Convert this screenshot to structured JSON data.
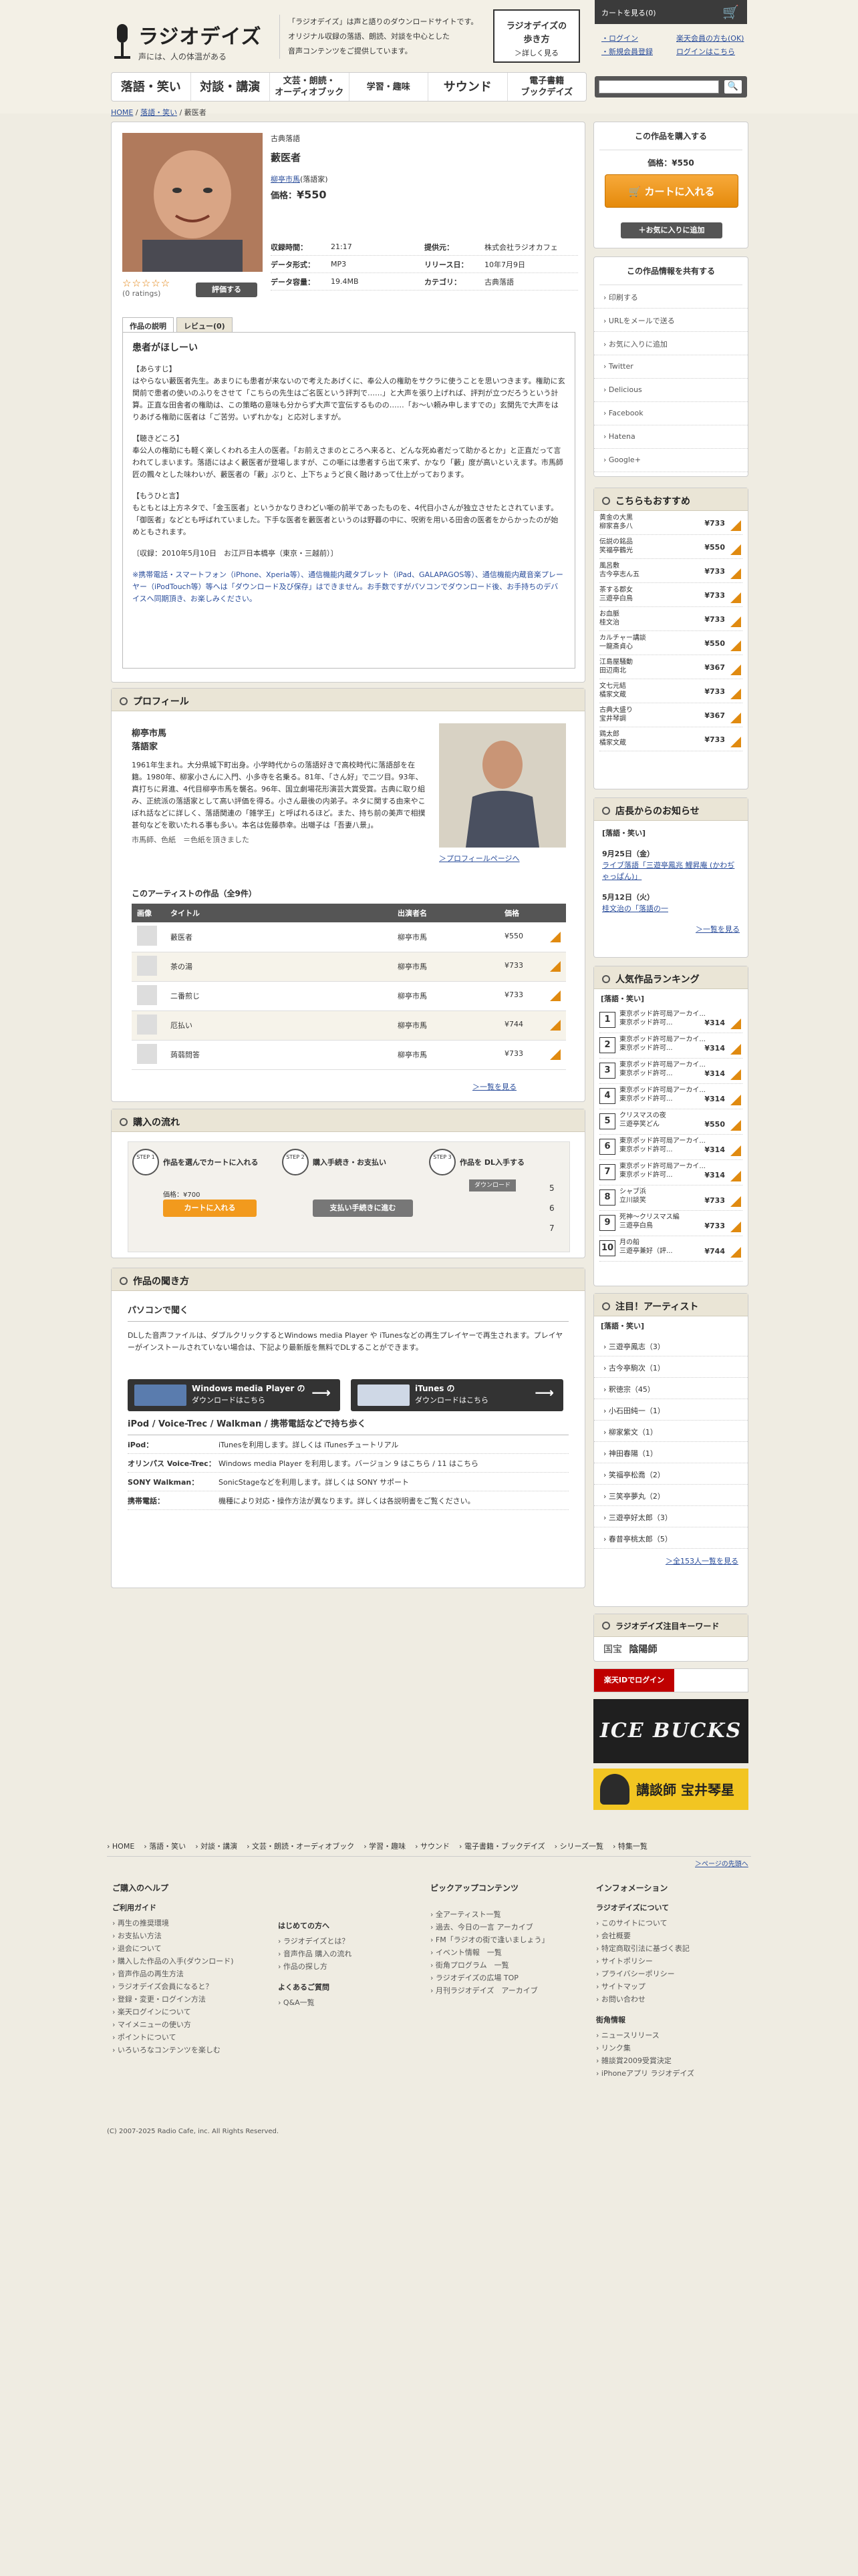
{
  "header": {
    "logo_title": "ラジオデイズ",
    "logo_sub": "声には、人の体温がある",
    "tagline": [
      "「ラジオデイズ」は声と語りのダウンロードサイトです。",
      "オリジナル収録の落語、朗読、対談を中心とした",
      "音声コンテンツをご提供しています。"
    ],
    "howto_l1": "ラジオデイズの",
    "howto_l2": "歩き方",
    "howto_l3": "＞詳しく見る",
    "cart_label": "カートを見る(0)",
    "links_left": [
      "・ログイン",
      "・新規会員登録"
    ],
    "links_right": [
      "楽天会員の方も(OK)",
      "ログインはこちら"
    ]
  },
  "nav": [
    {
      "label": "落語・笑い",
      "big": true
    },
    {
      "label": "対談・講演",
      "big": true
    },
    {
      "label": "文芸・朗読・\nオーディオブック",
      "big": false
    },
    {
      "label": "学習・趣味",
      "big": false
    },
    {
      "label": "サウンド",
      "big": true
    },
    {
      "label": "電子書籍\nブックデイズ",
      "big": false
    }
  ],
  "search": {
    "placeholder": "",
    "button": "🔍"
  },
  "breadcrumb": {
    "home": "HOME",
    "cat": "落語・笑い",
    "current": "藪医者"
  },
  "product": {
    "category": "古典落語",
    "title": "藪医者",
    "performer": "柳亭市馬",
    "performer_suffix": "(落語家)",
    "price_label": "価格：",
    "price": "¥550",
    "rating_stars": "☆☆☆☆☆",
    "rating_count": "(0 ratings)",
    "review_button": "評価する",
    "details": [
      {
        "k": "収録時間：",
        "v": "21:17",
        "k2": "提供元：",
        "v2": "株式会社ラジオカフェ"
      },
      {
        "k": "データ形式：",
        "v": "MP3",
        "k2": "リリース日：",
        "v2": "10年7月9日"
      },
      {
        "k": "データ容量：",
        "v": "19.4MB",
        "k2": "カテゴリ：",
        "v2": "古典落語"
      }
    ],
    "tabs": [
      "作品の説明",
      "レビュー(0)"
    ],
    "desc_heading": "患者がほしーい",
    "desc_paras": [
      "【あらすじ】\nはやらない藪医者先生。あまりにも患者が来ないので考えたあげくに、奉公人の権助をサクラに使うことを思いつきます。権助に玄関前で患者の使いのふりをさせて「こちらの先生はご名医という評判で……」と大声を張り上げれば、評判が立つだろうという計算。正直な田舎者の権助は、この策略の意味も分からず大声で宣伝するものの……「お〜い頼み申しますでの」玄関先で大声をはりあげる権助に医者は「ご苦労。いずれかな」と応対しますが。",
      "【聴きどころ】\n奉公人の権助にも軽く楽しくわれる主人の医者。「お前えさまのところへ来ると、どんな死ぬ者だって助かるとか」と正直だって言われてしまいます。落語にはよく藪医者が登場しますが、この噺には患者すら出て来ず、かなり「藪」度が高いといえます。市馬師匠の飄々とした味わいが、藪医者の「藪」ぶりと、上下ちょうど良く融けあって仕上がっております。",
      "【もうひと言】\nもともとは上方ネタで、「金玉医者」というかなりきわどい噺の前半であったものを、4代目小さんが独立させたとされています。「御医者」などとも呼ばれていました。下手な医者を藪医者というのは野暮の中に、呪術を用いる田舎の医者をからかったのが始めともされます。",
      "〔収録：2010年5月10日　お江戸日本橋亭（東京・三越前）〕"
    ],
    "desc_note": "※携帯電話・スマートフォン（iPhone、Xperia等）、通信機能内蔵タブレット（iPad、GALAPAGOS等）、通信機能内蔵音楽プレーヤー（iPodTouch等）等へは「ダウンロード及び保存」はできません。お手数ですがパソコンでダウンロード後、お手持ちのデバイスへ同期頂き、お楽しみください。"
  },
  "profile": {
    "title": "プロフィール",
    "name": "柳亭市馬",
    "role": "落語家",
    "text": "1961年生まれ。大分県城下町出身。小学時代からの落語好きで高校時代に落語部を在籍。1980年、柳家小さんに入門、小多寺を名乗る。81年、「さん好」で二ツ目。93年、真打ちに昇進、4代目柳亭市馬を襲名。96年、国立劇場花形演芸大賞受賞。古典に取り組み、正統派の落語家として高い評価を得る。小さん最後の内弟子。ネタに関する由来やこぼれ話などに詳しく、落語関連の「雑学王」と呼ばれるほど。また、持ち前の美声で相撲甚句などを歌いたれる事も多い。本名は佐藤恭幸。出囃子は「吾妻八景」。",
    "caption": "市馬師、色紙　＝色紙を頂きました",
    "more_link": "＞プロフィールページへ",
    "works_title": "このアーティストの作品（全9件）",
    "works_cols": [
      "画像",
      "タイトル",
      "出演者名",
      "価格"
    ],
    "works": [
      {
        "title": "藪医者",
        "artist": "柳亭市馬",
        "price": "¥550"
      },
      {
        "title": "茶の湯",
        "artist": "柳亭市馬",
        "price": "¥733"
      },
      {
        "title": "二番煎じ",
        "artist": "柳亭市馬",
        "price": "¥733"
      },
      {
        "title": "厄払い",
        "artist": "柳亭市馬",
        "price": "¥744"
      },
      {
        "title": "蒟蒻問答",
        "artist": "柳亭市馬",
        "price": "¥733"
      }
    ],
    "more": "＞一覧を見る"
  },
  "flow": {
    "title": "購入の流れ",
    "steps": [
      {
        "n": "STEP 1",
        "label": "作品を選んでカートに入れる"
      },
      {
        "n": "STEP 2",
        "label": "購入手続き・お支払い"
      },
      {
        "n": "STEP 3",
        "label": "作品を DL入手する"
      }
    ],
    "cart_btn": "カートに入れる",
    "pay_btn": "支払い手続きに進む",
    "dl_btn": "ダウンロード",
    "price_sample": "価格：¥700",
    "side_nums": [
      "5",
      "6",
      "7"
    ]
  },
  "listen": {
    "title": "作品の聞き方",
    "pc_heading": "パソコンで聞く",
    "pc_text": "DLした音声ファイルは、ダブルクリックするとWindows media Player や iTunesなどの再生プレイヤーで再生されます。プレイヤーがインストールされていない場合は、下記より最新版を無料でDLすることができます。",
    "wmp_l1": "Windows media Player の",
    "wmp_l2": "ダウンロードはこちら",
    "itunes_l1": "iTunes の",
    "itunes_l2": "ダウンロードはこちら",
    "dev_heading": "iPod / Voice-Trec / Walkman / 携帯電話などで持ち歩く",
    "devices": [
      {
        "k": "iPod：",
        "v": "iTunesを利用します。詳しくは iTunesチュートリアル"
      },
      {
        "k": "オリンパス Voice-Trec：",
        "v": "Windows media Player を利用します。バージョン 9 はこちら / 11 はこちら"
      },
      {
        "k": "SONY Walkman：",
        "v": "SonicStageなどを利用します。詳しくは SONY サポート"
      },
      {
        "k": "携帯電話：",
        "v": "機種により対応・操作方法が異なります。詳しくは各説明書をご覧ください。"
      }
    ]
  },
  "buy": {
    "title": "この作品を購入する",
    "price": "価格：¥550",
    "cart": "カートに入れる",
    "fav": "＋お気に入りに追加"
  },
  "share": {
    "title": "この作品情報を共有する",
    "items": [
      "印刷する",
      "URLをメールで送る",
      "お気に入りに追加",
      "Twitter",
      "Delicious",
      "Facebook",
      "Hatena",
      "Google+"
    ]
  },
  "recom": {
    "title": "こちらもおすすめ",
    "items": [
      {
        "t1": "黄金の大黒",
        "t2": "柳家喜多八",
        "p": "¥733"
      },
      {
        "t1": "伝説の銘品",
        "t2": "笑福亭鶴光",
        "p": "¥550"
      },
      {
        "t1": "風呂敷",
        "t2": "古今亭志ん五",
        "p": "¥733"
      },
      {
        "t1": "茶する郡女",
        "t2": "三遊亭白鳥",
        "p": "¥733"
      },
      {
        "t1": "お血脈",
        "t2": "桂文治",
        "p": "¥733"
      },
      {
        "t1": "カルチャー講談",
        "t2": "一龍斎貞心",
        "p": "¥550"
      },
      {
        "t1": "江島屋騒動",
        "t2": "田辺南北",
        "p": "¥367"
      },
      {
        "t1": "文七元結",
        "t2": "橘家文蔵",
        "p": "¥733"
      },
      {
        "t1": "古典大盛り",
        "t2": "宝井琴調",
        "p": "¥367"
      },
      {
        "t1": "鶏太郎",
        "t2": "橘家文蔵",
        "p": "¥733"
      }
    ]
  },
  "news": {
    "title": "店長からのお知らせ",
    "cat": "[落語・笑い]",
    "items": [
      {
        "date": "9月25日（金）",
        "text": "ライブ落語「三遊亭鳳兆 鯉昇庵 (かわぢゃっぱん)」"
      },
      {
        "date": "5月12日（火）",
        "text": "桂文治の「落語の一"
      }
    ],
    "more": "＞一覧を見る"
  },
  "ranking": {
    "title": "人気作品ランキング",
    "cat": "[落語・笑い]",
    "items": [
      {
        "t1": "東京ポッド許可局アーカイ...",
        "t2": "東京ポッド許可...",
        "p": "¥314"
      },
      {
        "t1": "東京ポッド許可局アーカイ...",
        "t2": "東京ポッド許可...",
        "p": "¥314"
      },
      {
        "t1": "東京ポッド許可局アーカイ...",
        "t2": "東京ポッド許可...",
        "p": "¥314"
      },
      {
        "t1": "東京ポッド許可局アーカイ...",
        "t2": "東京ポッド許可...",
        "p": "¥314"
      },
      {
        "t1": "クリスマスの夜",
        "t2": "三遊亭笑どん",
        "p": "¥550"
      },
      {
        "t1": "東京ポッド許可局アーカイ...",
        "t2": "東京ポッド許可...",
        "p": "¥314"
      },
      {
        "t1": "東京ポッド許可局アーカイ...",
        "t2": "東京ポッド許可...",
        "p": "¥314"
      },
      {
        "t1": "シャブ浜",
        "t2": "立川談笑",
        "p": "¥733"
      },
      {
        "t1": "死神〜クリスマス編",
        "t2": "三遊亭白鳥",
        "p": "¥733"
      },
      {
        "t1": "月の船",
        "t2": "三遊亭兼好（評...",
        "p": "¥744"
      }
    ]
  },
  "artists": {
    "title": "注目！アーティスト",
    "cat": "[落語・笑い]",
    "items": [
      "三遊亭鳳志（3）",
      "古今亭駒次（1）",
      "釈徳宗（45）",
      "小石田純一（1）",
      "柳家紫文（1）",
      "神田春陽（1）",
      "笑福亭松喬（2）",
      "三笑亭夢丸（2）",
      "三遊亭好太郎（3）",
      "春昔亭桃太郎（5）"
    ],
    "more": "＞全153人一覧を見る"
  },
  "keyword": {
    "title": "ラジオデイズ注目キーワード",
    "items": [
      "国宝",
      "陰陽師"
    ]
  },
  "banners": {
    "rakuten": "楽天IDでログイン",
    "icebucks": "ICE BUCKS",
    "koudan": "講談師 宝井琴星"
  },
  "footnav": [
    "HOME",
    "落語・笑い",
    "対談・講演",
    "文芸・朗読・オーディオブック",
    "学習・趣味",
    "サウンド",
    "電子書籍・ブックデイズ",
    "シリーズ一覧",
    "特集一覧"
  ],
  "pagetop": "＞ページの先頭へ",
  "footer": {
    "col1_title": "ご購入のヘルプ",
    "guide_title": "ご利用ガイド",
    "guide": [
      "再生の推奨環境",
      "お支払い方法",
      "退会について",
      "購入した作品の入手(ダウンロード)",
      "音声作品の再生方法",
      "ラジオデイズ会員になると？",
      "登録・変更・ログイン方法",
      "楽天ログインについて",
      "マイメニューの使い方",
      "ポイントについて",
      "いろいろなコンテンツを楽しむ"
    ],
    "first_title": "はじめての方へ",
    "first": [
      "ラジオデイズとは？",
      "音声作品 購入の流れ",
      "作品の探し方"
    ],
    "qa_title": "よくあるご質問",
    "qa": [
      "Q&A一覧"
    ],
    "col2_title": "ピックアップコンテンツ",
    "pickup": [
      "全アーティスト一覧",
      "過去、今日の一言 アーカイブ",
      "FM「ラジオの街で逢いましょう」",
      "イベント情報　一覧",
      "街角プログラム　一覧",
      "ラジオデイズの広場 TOP",
      "月刊ラジオデイズ　アーカイブ"
    ],
    "col3_title": "インフォメーション",
    "about_title": "ラジオデイズについて",
    "about": [
      "このサイトについて",
      "会社概要",
      "特定商取引法に基づく表記",
      "サイトポリシー",
      "プライバシーポリシー",
      "サイトマップ",
      "お問い合わせ"
    ],
    "corner_title": "街角情報",
    "corner": [
      "ニュースリリース",
      "リンク集",
      "雑談賞2009受賞決定",
      "iPhoneアプリ ラジオデイズ"
    ]
  },
  "copyright": "(C) 2007-2025 Radio Cafe, inc. All Rights Reserved."
}
